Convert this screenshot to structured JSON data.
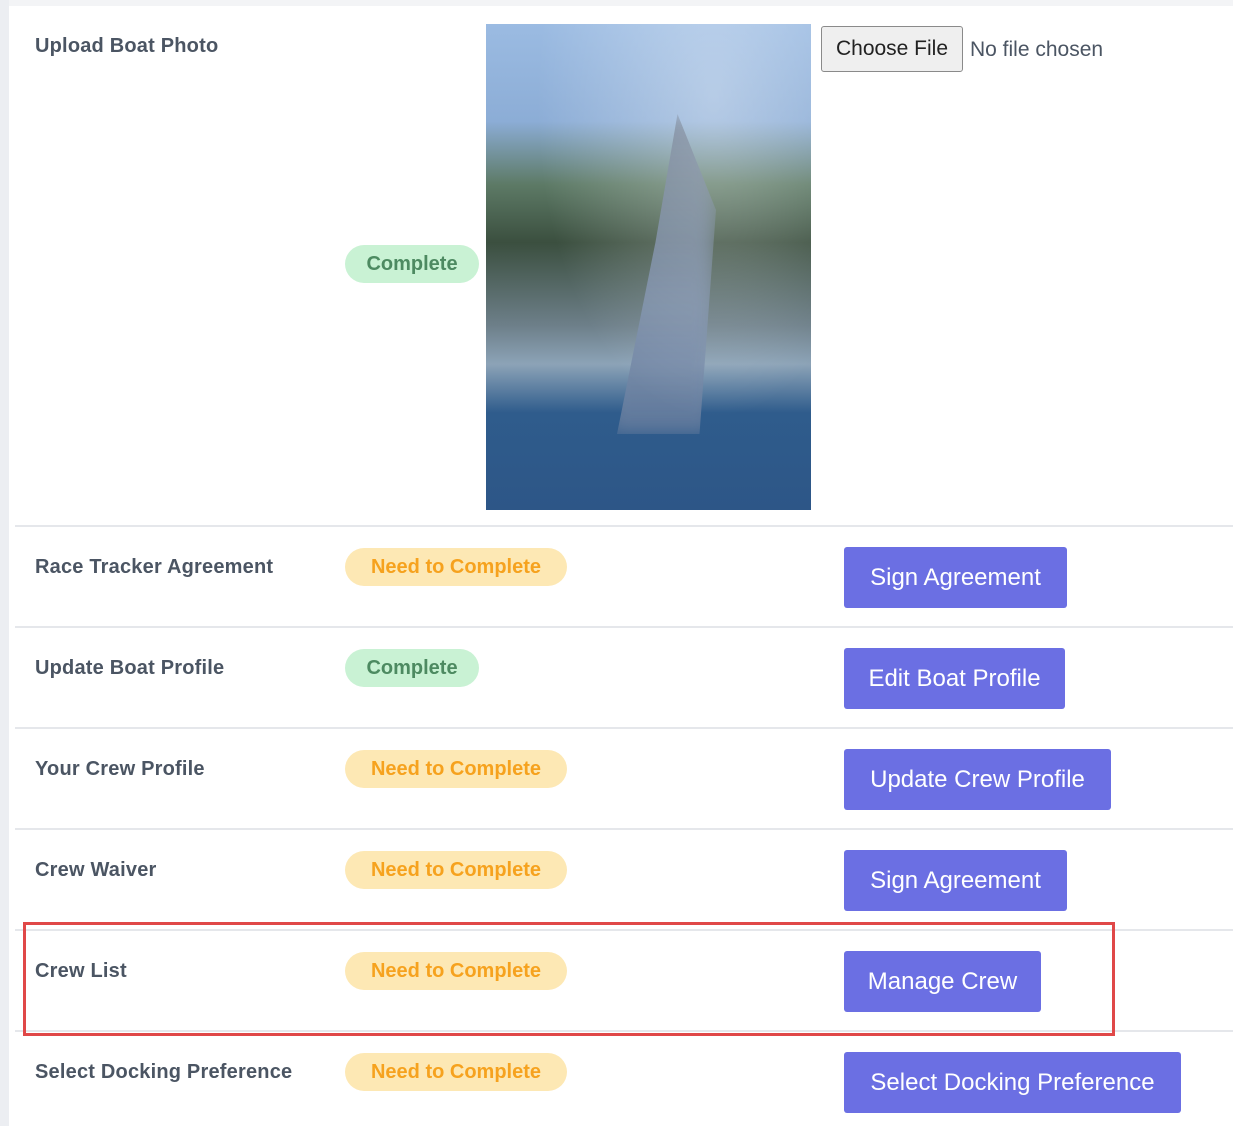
{
  "tasks": [
    {
      "label": "Upload Boat Photo",
      "status": "Complete",
      "status_type": "complete"
    },
    {
      "label": "Race Tracker Agreement",
      "status": "Need to Complete",
      "status_type": "pending",
      "action": "Sign Agreement"
    },
    {
      "label": "Update Boat Profile",
      "status": "Complete",
      "status_type": "complete",
      "action": "Edit Boat Profile"
    },
    {
      "label": "Your Crew Profile",
      "status": "Need to Complete",
      "status_type": "pending",
      "action": "Update Crew Profile"
    },
    {
      "label": "Crew Waiver",
      "status": "Need to Complete",
      "status_type": "pending",
      "action": "Sign Agreement"
    },
    {
      "label": "Crew List",
      "status": "Need to Complete",
      "status_type": "pending",
      "action": "Manage Crew",
      "highlighted": true
    },
    {
      "label": "Select Docking Preference",
      "status": "Need to Complete",
      "status_type": "pending",
      "action": "Select Docking Preference"
    }
  ],
  "file_input": {
    "button_label": "Choose File",
    "status_text": "No file chosen"
  },
  "colors": {
    "complete_bg": "#c9f2d4",
    "complete_text": "#4d8a61",
    "pending_bg": "#fde8b4",
    "pending_text": "#f6a21e",
    "button": "#6b6fe3",
    "highlight_border": "#e04848"
  }
}
